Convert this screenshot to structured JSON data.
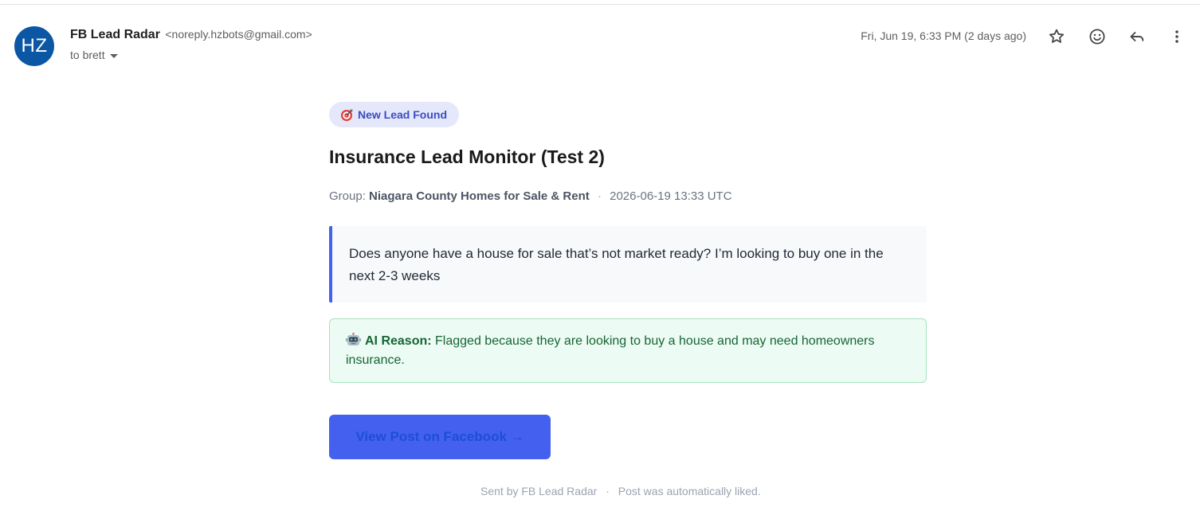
{
  "colors": {
    "avatar_bg": "#0b57a4",
    "accent_blue": "#4361ee",
    "badge_bg": "#e5e8fb",
    "badge_text": "#3b4cc0",
    "ai_bg": "#ecfbf3",
    "ai_border": "#a7e3c0",
    "ai_text": "#166534",
    "cta_text": "#1d4ed8"
  },
  "header": {
    "avatar_initials": "HZ",
    "sender_name": "FB Lead Radar",
    "sender_email": "<noreply.hzbots@gmail.com>",
    "to_label": "to brett",
    "timestamp": "Fri, Jun 19, 6:33 PM (2 days ago)",
    "icons": [
      "star-icon",
      "emoji-icon",
      "reply-icon",
      "more-vert-icon"
    ]
  },
  "email": {
    "badge": {
      "icon": "target-icon",
      "label": "New Lead Found"
    },
    "title": "Insurance Lead Monitor (Test 2)",
    "meta": {
      "group_label": "Group:",
      "group_name": "Niagara County Homes for Sale & Rent",
      "separator": "·",
      "datetime": "2026-06-19 13:33 UTC"
    },
    "post_text": "Does anyone have a house for sale that’s not market ready? I’m looking to buy one in the next 2-3 weeks",
    "ai_reason": {
      "icon": "robot-icon",
      "label": "AI Reason:",
      "text": "Flagged because they are looking to buy a house and may need homeowners insurance."
    },
    "cta_label": "View Post on Facebook →",
    "footer": {
      "sent_by": "Sent by FB Lead Radar",
      "separator": "·",
      "note": "Post was automatically liked."
    }
  }
}
